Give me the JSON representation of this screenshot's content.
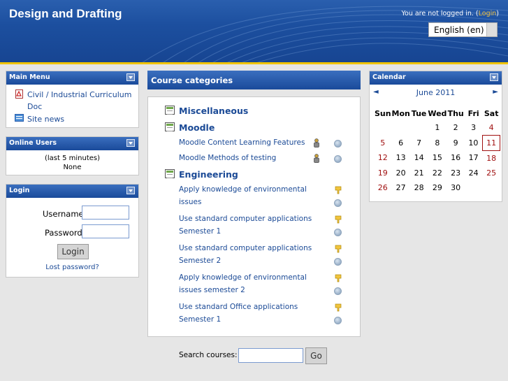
{
  "header": {
    "site_title": "Design and Drafting",
    "login_status": "You are not logged in. (",
    "login_link": "Login",
    "login_close": ")",
    "language": "English (en)"
  },
  "main_menu": {
    "title": "Main Menu",
    "items": [
      {
        "label": "Civil / Industrial Curriculum",
        "label2": "Doc",
        "icon": "pdf-icon"
      },
      {
        "label": "Site news",
        "icon": "news-icon"
      }
    ]
  },
  "online_users": {
    "title": "Online Users",
    "period": "(last 5 minutes)",
    "users": "None"
  },
  "login": {
    "title": "Login",
    "username_label": "Username",
    "password_label": "Password",
    "login_button": "Login",
    "lost_password": "Lost password?"
  },
  "course_categories": {
    "title": "Course categories",
    "categories": [
      {
        "name": "Miscellaneous",
        "courses": []
      },
      {
        "name": "Moodle",
        "courses": [
          {
            "line1": "Moodle Content Learning Features",
            "line2": ""
          },
          {
            "line1": "Moodle Methods of testing",
            "line2": ""
          }
        ]
      },
      {
        "name": "Engineering",
        "courses": [
          {
            "line1": "Apply knowledge of environmental",
            "line2": "issues"
          },
          {
            "line1": "Use standard computer applications",
            "line2": "Semester 1"
          },
          {
            "line1": "Use standard computer applications",
            "line2": "Semester 2"
          },
          {
            "line1": "Apply knowledge of environmental",
            "line2": "issues semester 2"
          },
          {
            "line1": "Use standard Office applications",
            "line2": "Semester 1"
          }
        ]
      }
    ]
  },
  "search": {
    "label": "Search courses:",
    "button": "Go",
    "value": ""
  },
  "calendar": {
    "title": "Calendar",
    "prev": "◄",
    "next": "►",
    "month": "June 2011",
    "weekdays": [
      "Sun",
      "Mon",
      "Tue",
      "Wed",
      "Thu",
      "Fri",
      "Sat"
    ],
    "weeks": [
      [
        "",
        "",
        "",
        "1",
        "2",
        "3",
        "4"
      ],
      [
        "5",
        "6",
        "7",
        "8",
        "9",
        "10",
        "11"
      ],
      [
        "12",
        "13",
        "14",
        "15",
        "16",
        "17",
        "18"
      ],
      [
        "19",
        "20",
        "21",
        "22",
        "23",
        "24",
        "25"
      ],
      [
        "26",
        "27",
        "28",
        "29",
        "30",
        "",
        ""
      ]
    ],
    "today": "11"
  },
  "colors": {
    "header_blue": "#1c4f9f",
    "accent_yellow": "#f0c400",
    "link_blue": "#1b4a96",
    "weekend_red": "#a01010"
  }
}
